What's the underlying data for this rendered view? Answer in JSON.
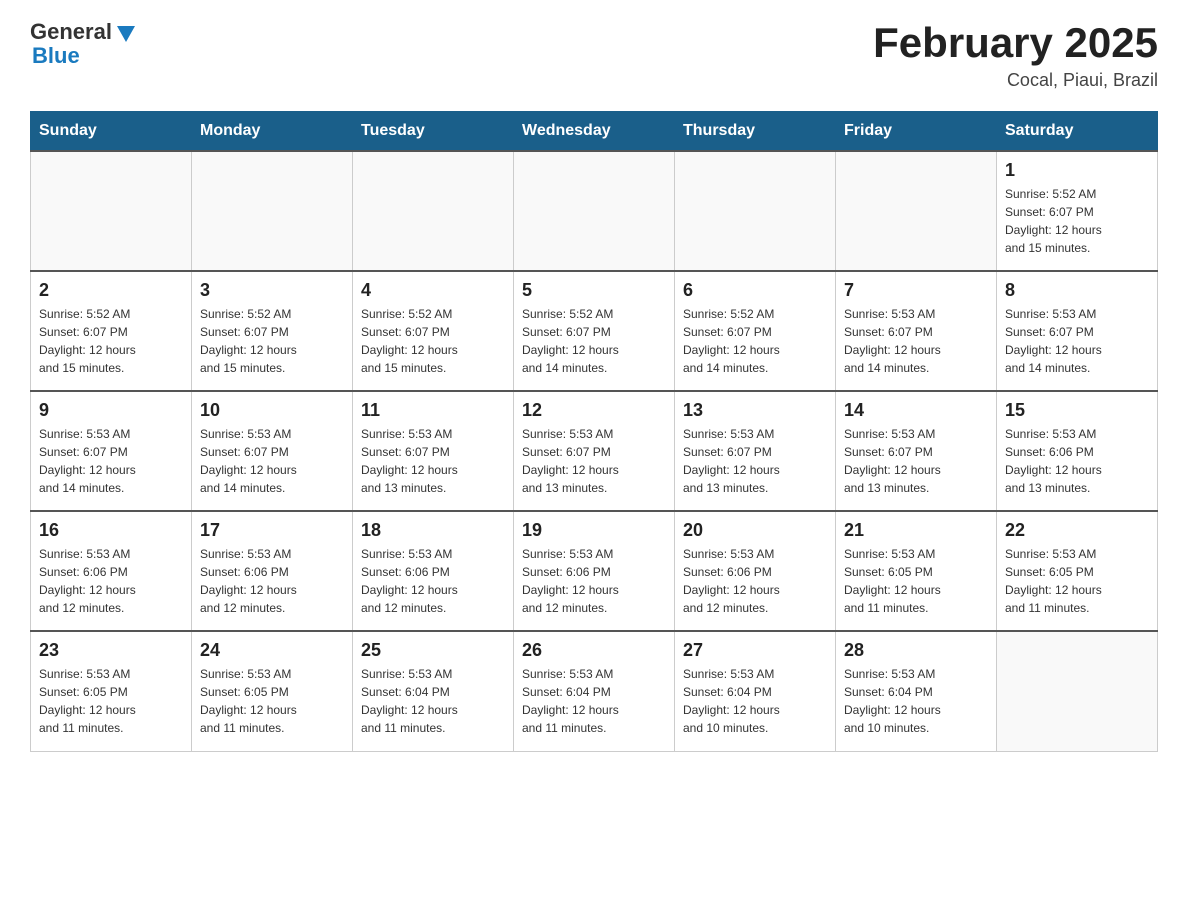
{
  "header": {
    "logo": {
      "general": "General",
      "blue": "Blue"
    },
    "title": "February 2025",
    "location": "Cocal, Piaui, Brazil"
  },
  "days_of_week": [
    "Sunday",
    "Monday",
    "Tuesday",
    "Wednesday",
    "Thursday",
    "Friday",
    "Saturday"
  ],
  "weeks": [
    [
      {
        "day": "",
        "info": ""
      },
      {
        "day": "",
        "info": ""
      },
      {
        "day": "",
        "info": ""
      },
      {
        "day": "",
        "info": ""
      },
      {
        "day": "",
        "info": ""
      },
      {
        "day": "",
        "info": ""
      },
      {
        "day": "1",
        "info": "Sunrise: 5:52 AM\nSunset: 6:07 PM\nDaylight: 12 hours\nand 15 minutes."
      }
    ],
    [
      {
        "day": "2",
        "info": "Sunrise: 5:52 AM\nSunset: 6:07 PM\nDaylight: 12 hours\nand 15 minutes."
      },
      {
        "day": "3",
        "info": "Sunrise: 5:52 AM\nSunset: 6:07 PM\nDaylight: 12 hours\nand 15 minutes."
      },
      {
        "day": "4",
        "info": "Sunrise: 5:52 AM\nSunset: 6:07 PM\nDaylight: 12 hours\nand 15 minutes."
      },
      {
        "day": "5",
        "info": "Sunrise: 5:52 AM\nSunset: 6:07 PM\nDaylight: 12 hours\nand 14 minutes."
      },
      {
        "day": "6",
        "info": "Sunrise: 5:52 AM\nSunset: 6:07 PM\nDaylight: 12 hours\nand 14 minutes."
      },
      {
        "day": "7",
        "info": "Sunrise: 5:53 AM\nSunset: 6:07 PM\nDaylight: 12 hours\nand 14 minutes."
      },
      {
        "day": "8",
        "info": "Sunrise: 5:53 AM\nSunset: 6:07 PM\nDaylight: 12 hours\nand 14 minutes."
      }
    ],
    [
      {
        "day": "9",
        "info": "Sunrise: 5:53 AM\nSunset: 6:07 PM\nDaylight: 12 hours\nand 14 minutes."
      },
      {
        "day": "10",
        "info": "Sunrise: 5:53 AM\nSunset: 6:07 PM\nDaylight: 12 hours\nand 14 minutes."
      },
      {
        "day": "11",
        "info": "Sunrise: 5:53 AM\nSunset: 6:07 PM\nDaylight: 12 hours\nand 13 minutes."
      },
      {
        "day": "12",
        "info": "Sunrise: 5:53 AM\nSunset: 6:07 PM\nDaylight: 12 hours\nand 13 minutes."
      },
      {
        "day": "13",
        "info": "Sunrise: 5:53 AM\nSunset: 6:07 PM\nDaylight: 12 hours\nand 13 minutes."
      },
      {
        "day": "14",
        "info": "Sunrise: 5:53 AM\nSunset: 6:07 PM\nDaylight: 12 hours\nand 13 minutes."
      },
      {
        "day": "15",
        "info": "Sunrise: 5:53 AM\nSunset: 6:06 PM\nDaylight: 12 hours\nand 13 minutes."
      }
    ],
    [
      {
        "day": "16",
        "info": "Sunrise: 5:53 AM\nSunset: 6:06 PM\nDaylight: 12 hours\nand 12 minutes."
      },
      {
        "day": "17",
        "info": "Sunrise: 5:53 AM\nSunset: 6:06 PM\nDaylight: 12 hours\nand 12 minutes."
      },
      {
        "day": "18",
        "info": "Sunrise: 5:53 AM\nSunset: 6:06 PM\nDaylight: 12 hours\nand 12 minutes."
      },
      {
        "day": "19",
        "info": "Sunrise: 5:53 AM\nSunset: 6:06 PM\nDaylight: 12 hours\nand 12 minutes."
      },
      {
        "day": "20",
        "info": "Sunrise: 5:53 AM\nSunset: 6:06 PM\nDaylight: 12 hours\nand 12 minutes."
      },
      {
        "day": "21",
        "info": "Sunrise: 5:53 AM\nSunset: 6:05 PM\nDaylight: 12 hours\nand 11 minutes."
      },
      {
        "day": "22",
        "info": "Sunrise: 5:53 AM\nSunset: 6:05 PM\nDaylight: 12 hours\nand 11 minutes."
      }
    ],
    [
      {
        "day": "23",
        "info": "Sunrise: 5:53 AM\nSunset: 6:05 PM\nDaylight: 12 hours\nand 11 minutes."
      },
      {
        "day": "24",
        "info": "Sunrise: 5:53 AM\nSunset: 6:05 PM\nDaylight: 12 hours\nand 11 minutes."
      },
      {
        "day": "25",
        "info": "Sunrise: 5:53 AM\nSunset: 6:04 PM\nDaylight: 12 hours\nand 11 minutes."
      },
      {
        "day": "26",
        "info": "Sunrise: 5:53 AM\nSunset: 6:04 PM\nDaylight: 12 hours\nand 11 minutes."
      },
      {
        "day": "27",
        "info": "Sunrise: 5:53 AM\nSunset: 6:04 PM\nDaylight: 12 hours\nand 10 minutes."
      },
      {
        "day": "28",
        "info": "Sunrise: 5:53 AM\nSunset: 6:04 PM\nDaylight: 12 hours\nand 10 minutes."
      },
      {
        "day": "",
        "info": ""
      }
    ]
  ]
}
